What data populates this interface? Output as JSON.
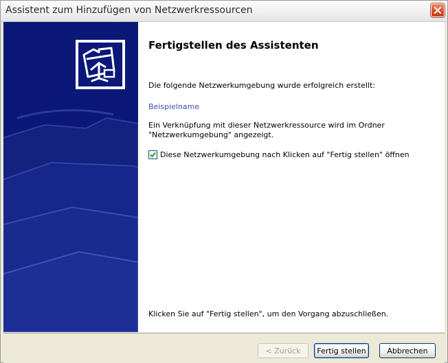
{
  "window": {
    "title": "Assistent zum Hinzufügen von Netzwerkressourcen",
    "close_icon": "close-icon"
  },
  "sidebar": {
    "icon": "network-folder-icon",
    "background_color": "#0c1878"
  },
  "main": {
    "heading": "Fertigstellen des Assistenten",
    "success_text": "Die folgende Netzwerkumgebung wurde erfolgreich erstellt:",
    "resource_name": "Beispielname",
    "info_text": "Ein Verknüpfung mit dieser Netzwerkressource wird im Ordner \"Netzwerkumgebung\" angezeigt.",
    "open_checkbox": {
      "label": "Diese Netzwerkumgebung nach Klicken auf \"Fertig stellen\" öffnen",
      "checked": true
    },
    "finish_hint": "Klicken Sie auf \"Fertig stellen\", um den Vorgang abzuschließen."
  },
  "buttons": {
    "back": "< Zurück",
    "finish": "Fertig stellen",
    "cancel": "Abbrechen"
  }
}
